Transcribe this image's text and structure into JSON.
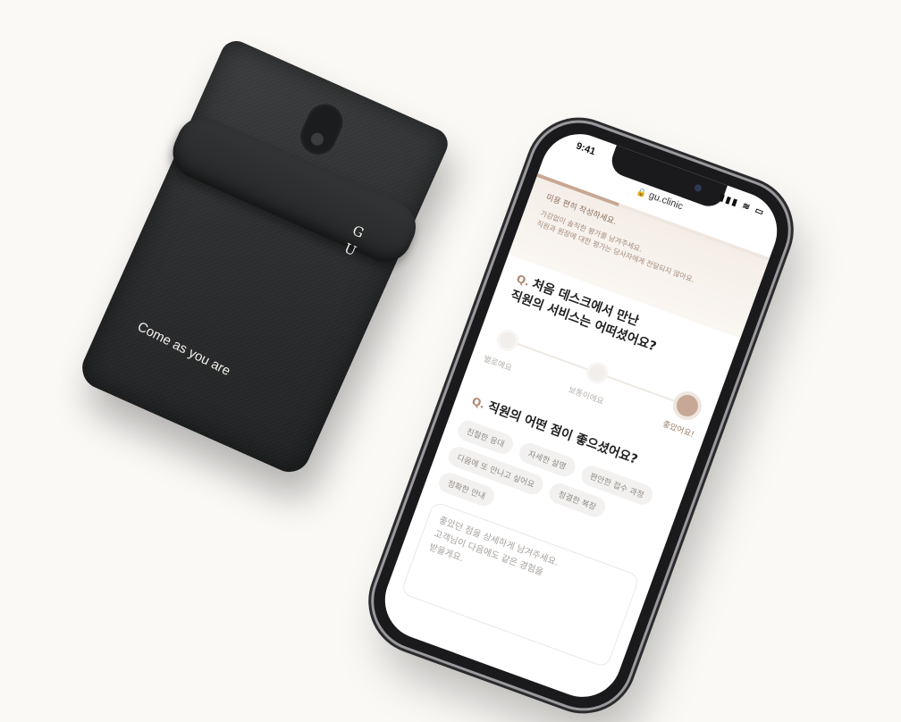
{
  "pouch": {
    "logo_top": "G",
    "logo_bottom": "U",
    "slogan": "Come as you are"
  },
  "phone": {
    "status_time": "9:41",
    "status_icons": "▮▮▮ ≋ ▭",
    "url": "gu.clinic",
    "progress_percent": 35,
    "survey": {
      "title": "미용 편히 작성하세요.",
      "desc_lines": [
        "가감없이 솔직한 평가를 남겨주세요.",
        "직원과 원장에 대한 평가는 당사자에게 전달되지 않아요."
      ]
    },
    "question1": {
      "mark": "Q.",
      "lines": [
        "처음 데스크에서 만난",
        "직원의 서비스는 어떠셨어요?"
      ]
    },
    "rating": {
      "labels": [
        "별로예요",
        "보통이에요",
        "좋았어요!"
      ],
      "selected_index": 2
    },
    "question2": {
      "mark": "Q.",
      "text": "직원의 어떤 점이 좋으셨어요?"
    },
    "options": [
      "친절한 응대",
      "자세한 설명",
      "편안한 접수 과정",
      "다음에 또 만나고 싶어요",
      "청결한 복장",
      "정확한 안내"
    ],
    "comment_lines": [
      "좋았던 점을 상세하게 남겨주세요.",
      "고객님이 다음에도 같은 경험을",
      "받을게요."
    ]
  },
  "colors": {
    "accent": "#c7a896",
    "background": "#fbf9f6",
    "pouch": "#2a2c2d"
  }
}
